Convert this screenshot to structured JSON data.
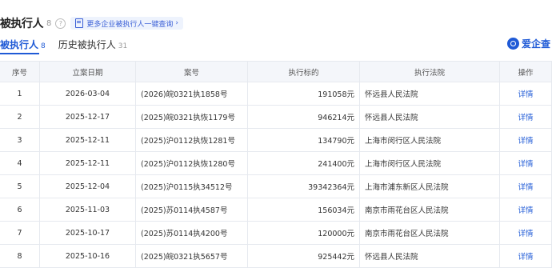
{
  "header": {
    "title": "被执行人",
    "count": "8",
    "help_glyph": "?",
    "promo_label": "更多企业被执行人一键查询",
    "promo_chevron": "›"
  },
  "tabs": [
    {
      "label": "被执行人",
      "count": "8"
    },
    {
      "label": "历史被执行人",
      "count": "31"
    }
  ],
  "logo": {
    "text": "爱企查"
  },
  "table": {
    "columns": [
      "序号",
      "立案日期",
      "案号",
      "执行标的",
      "执行法院",
      "操作"
    ],
    "rows": [
      {
        "no": "1",
        "date": "2026-03-04",
        "case": "(2026)皖0321执1858号",
        "amount": "191058元",
        "court": "怀远县人民法院",
        "action": "详情"
      },
      {
        "no": "2",
        "date": "2025-12-17",
        "case": "(2025)皖0321执恢1179号",
        "amount": "946214元",
        "court": "怀远县人民法院",
        "action": "详情"
      },
      {
        "no": "3",
        "date": "2025-12-11",
        "case": "(2025)沪0112执恢1281号",
        "amount": "134790元",
        "court": "上海市闵行区人民法院",
        "action": "详情"
      },
      {
        "no": "4",
        "date": "2025-12-11",
        "case": "(2025)沪0112执恢1280号",
        "amount": "241400元",
        "court": "上海市闵行区人民法院",
        "action": "详情"
      },
      {
        "no": "5",
        "date": "2025-12-04",
        "case": "(2025)沪0115执34512号",
        "amount": "39342364元",
        "court": "上海市浦东新区人民法院",
        "action": "详情"
      },
      {
        "no": "6",
        "date": "2025-11-03",
        "case": "(2025)苏0114执4587号",
        "amount": "156034元",
        "court": "南京市雨花台区人民法院",
        "action": "详情"
      },
      {
        "no": "7",
        "date": "2025-10-17",
        "case": "(2025)苏0114执4200号",
        "amount": "120000元",
        "court": "南京市雨花台区人民法院",
        "action": "详情"
      },
      {
        "no": "8",
        "date": "2025-10-16",
        "case": "(2025)皖0321执5657号",
        "amount": "925442元",
        "court": "怀远县人民法院",
        "action": "详情"
      }
    ]
  }
}
